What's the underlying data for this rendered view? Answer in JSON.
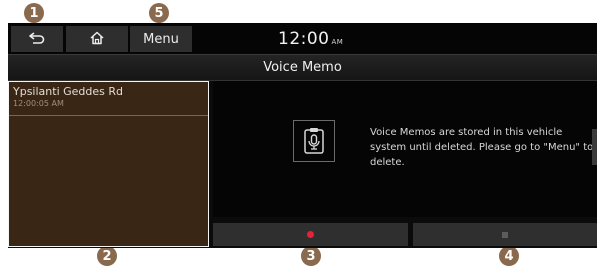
{
  "callouts": [
    "1",
    "2",
    "3",
    "4",
    "5"
  ],
  "header": {
    "back_icon": "back-arrow-icon",
    "home_icon": "home-icon",
    "menu_label": "Menu",
    "time": "12:00",
    "ampm": "AM"
  },
  "title": "Voice Memo",
  "memo_list": {
    "items": [
      {
        "title": "Ypsilanti Geddes Rd",
        "time": "12:00:05 AM"
      }
    ]
  },
  "info": {
    "icon": "voice-memo-icon",
    "message": "Voice Memos are stored in this vehicle system until deleted. Please go to \"Menu\" to delete."
  },
  "controls": {
    "record_icon": "record-icon",
    "stop_icon": "stop-icon"
  },
  "colors": {
    "callout": "#8a6a4e",
    "list_background": "#3a2614",
    "record_dot": "#e0243a"
  }
}
